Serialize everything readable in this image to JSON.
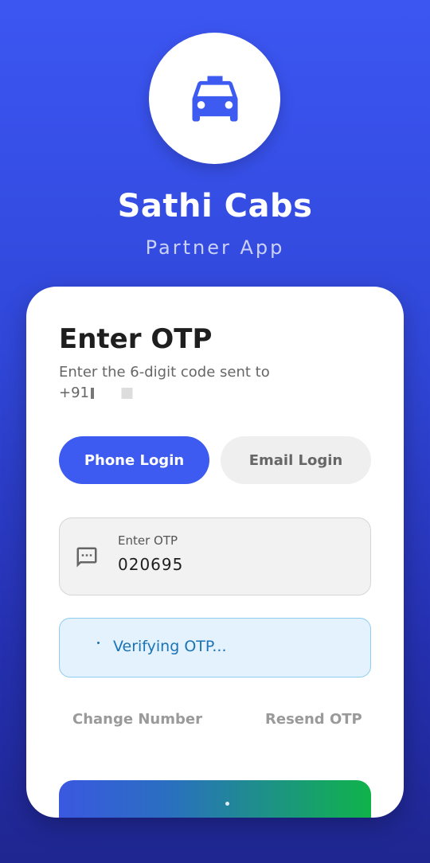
{
  "app": {
    "title": "Sathi Cabs",
    "subtitle": "Partner App",
    "logo_icon": "taxi-icon"
  },
  "card": {
    "title": "Enter OTP",
    "description": "Enter the 6-digit code sent to",
    "phone_prefix": "+91"
  },
  "tabs": [
    {
      "label": "Phone Login",
      "active": true
    },
    {
      "label": "Email Login",
      "active": false
    }
  ],
  "otp_field": {
    "icon": "message-icon",
    "label": "Enter OTP",
    "value": "020695"
  },
  "status": {
    "text": "Verifying OTP..."
  },
  "links": {
    "change_number": "Change Number",
    "resend_otp": "Resend OTP"
  },
  "colors": {
    "primary": "#3d5af1",
    "status_text": "#1a73b5",
    "status_bg": "#e3f2fc",
    "button_gradient_start": "#3a58e0",
    "button_gradient_end": "#0fb34a"
  }
}
